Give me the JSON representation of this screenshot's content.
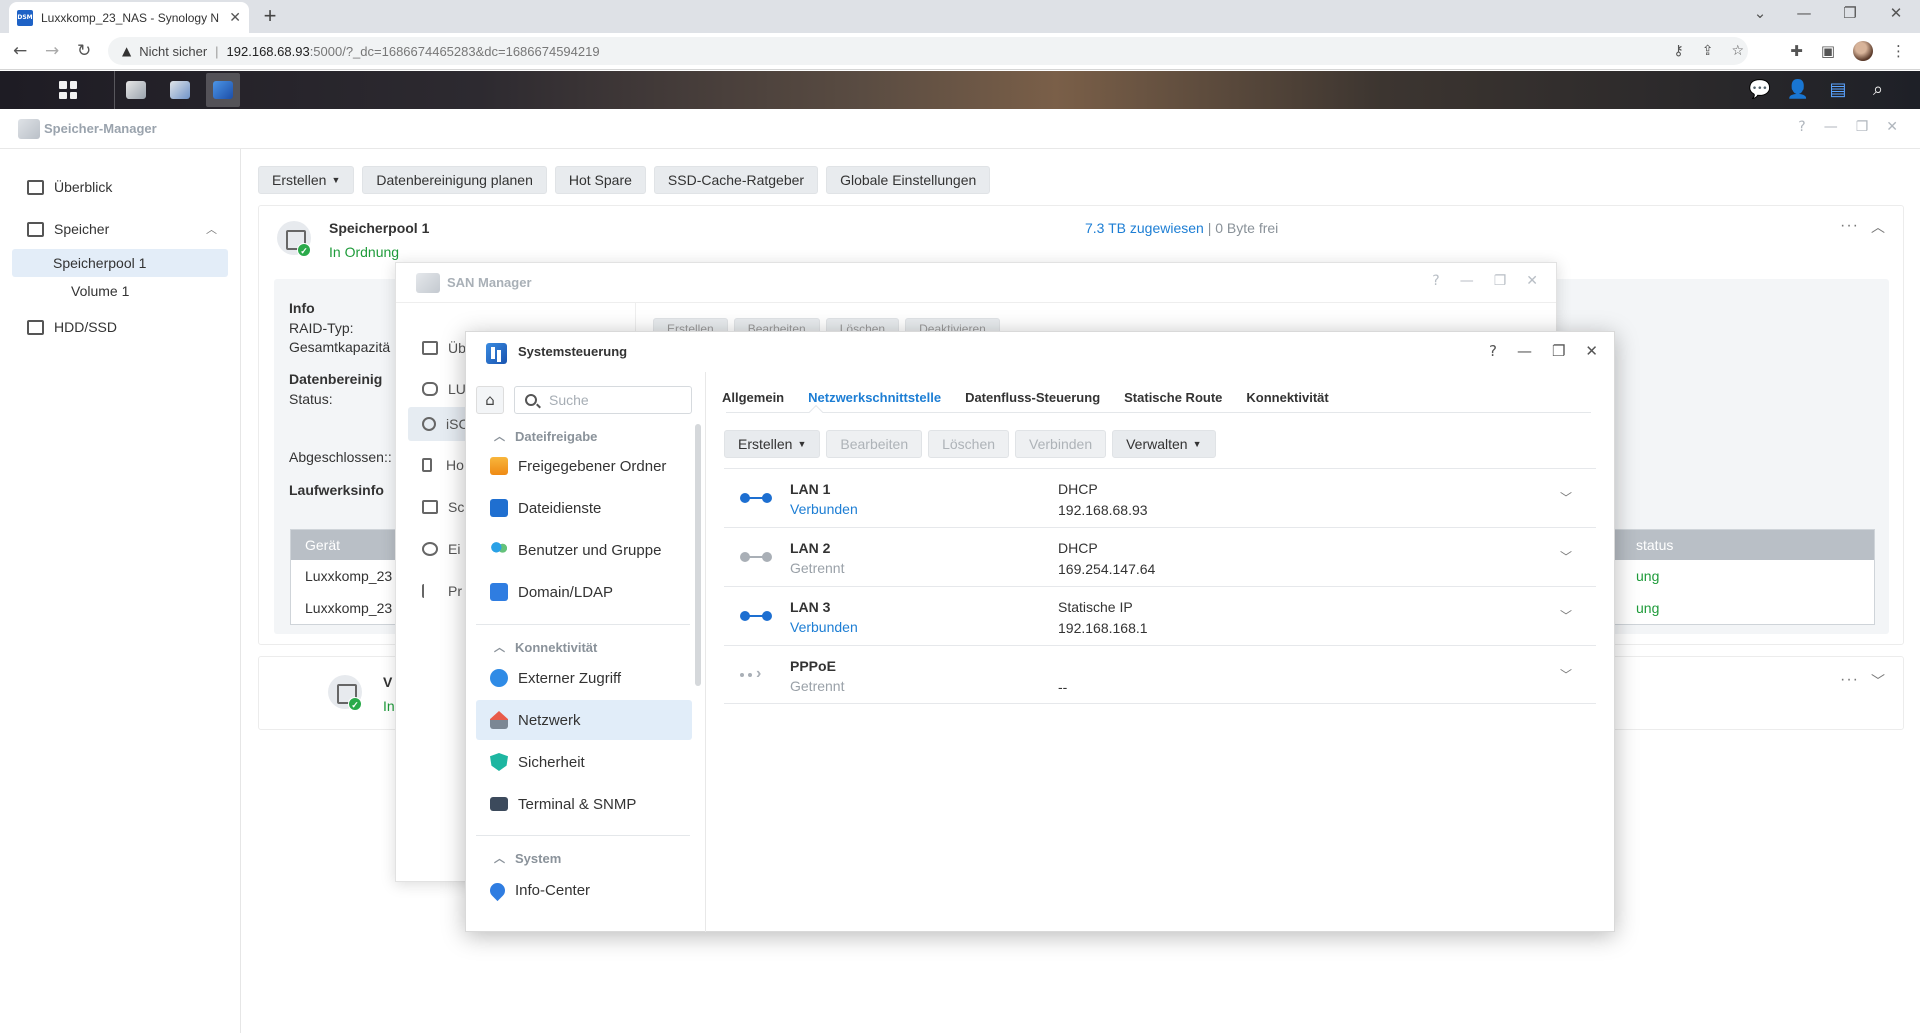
{
  "browser": {
    "tab_title": "Luxxkomp_23_NAS - Synology N",
    "favicon_text": "DSM",
    "security_label": "Nicht sicher",
    "url_host": "192.168.68.93",
    "url_rest": ":5000/?_dc=1686674465283&dc=1686674594219"
  },
  "storage_manager": {
    "title": "Speicher-Manager",
    "sidebar": {
      "overview": "Überblick",
      "storage": "Speicher",
      "pool1": "Speicherpool 1",
      "volume1": "Volume 1",
      "hdd": "HDD/SSD"
    },
    "toolbar": {
      "create": "Erstellen",
      "schedule_scrub": "Datenbereinigung planen",
      "hot_spare": "Hot Spare",
      "ssd_cache": "SSD-Cache-Ratgeber",
      "global_settings": "Globale Einstellungen"
    },
    "pool": {
      "name": "Speicherpool 1",
      "status": "In Ordnung",
      "allocated": "7.3 TB zugewiesen",
      "separator": "|",
      "free": "0 Byte frei",
      "info_heading": "Info",
      "raid_label": "RAID-Typ:",
      "capacity_label": "Gesamtkapazitä",
      "scrub_heading": "Datenbereinig",
      "status_label": "Status:",
      "completed_label": "Abgeschlossen::",
      "drive_info_heading": "Laufwerksinfo",
      "drive_table_header": "Gerät",
      "drive_table_status_header": "status",
      "drives": [
        "Luxxkomp_23",
        "Luxxkomp_23"
      ],
      "drive_status": [
        "ung",
        "ung"
      ]
    },
    "volume": {
      "name": "V",
      "status": "In"
    }
  },
  "san_manager": {
    "title": "SAN Manager",
    "sidebar": [
      "Üb",
      "LU",
      "iSC",
      "Ho",
      "Sc",
      "Ei",
      "Pr"
    ],
    "toolbar": [
      "Erstellen",
      "Bearbeiten",
      "Löschen",
      "Deaktivieren"
    ]
  },
  "control_panel": {
    "title": "Systemsteuerung",
    "search_placeholder": "Suche",
    "sections": {
      "file_sharing": "Dateifreigabe",
      "connectivity": "Konnektivität",
      "system": "System"
    },
    "items": {
      "shared_folder": "Freigegebener Ordner",
      "file_services": "Dateidienste",
      "user_group": "Benutzer und Gruppe",
      "domain_ldap": "Domain/LDAP",
      "external_access": "Externer Zugriff",
      "network": "Netzwerk",
      "security": "Sicherheit",
      "terminal_snmp": "Terminal & SNMP",
      "info_center": "Info-Center"
    },
    "tabs": {
      "general": "Allgemein",
      "network_interface": "Netzwerkschnittstelle",
      "traffic_control": "Datenfluss-Steuerung",
      "static_route": "Statische Route",
      "connectivity": "Konnektivität"
    },
    "toolbar": {
      "create": "Erstellen",
      "edit": "Bearbeiten",
      "delete": "Löschen",
      "connect": "Verbinden",
      "manage": "Verwalten"
    },
    "interfaces": [
      {
        "name": "LAN 1",
        "status": "Verbunden",
        "type": "DHCP",
        "ip": "192.168.68.93"
      },
      {
        "name": "LAN 2",
        "status": "Getrennt",
        "type": "DHCP",
        "ip": "169.254.147.64"
      },
      {
        "name": "LAN 3",
        "status": "Verbunden",
        "type": "Statische IP",
        "ip": "192.168.168.1"
      },
      {
        "name": "PPPoE",
        "status": "Getrennt",
        "type": "",
        "ip": "--"
      }
    ]
  },
  "colors": {
    "accent": "#1d7ed4",
    "ok_green": "#1e9b3a",
    "disconnected": "#9aa1a8"
  }
}
